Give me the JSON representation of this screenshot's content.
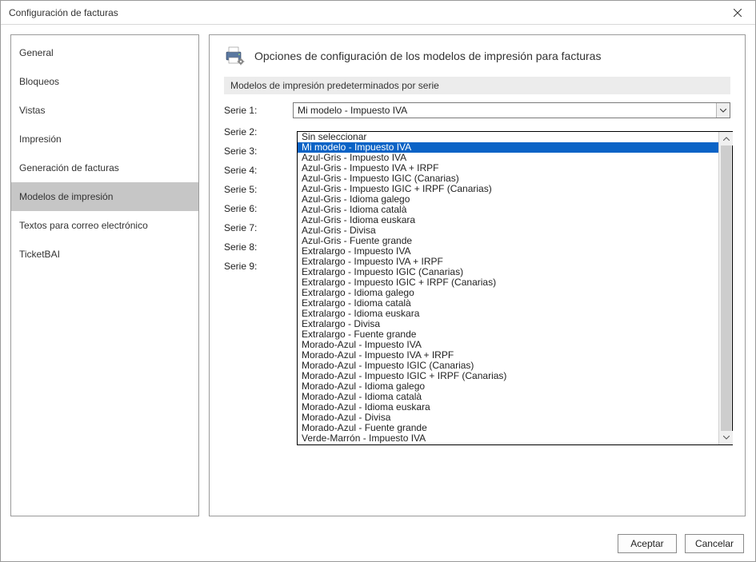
{
  "window": {
    "title": "Configuración de facturas"
  },
  "sidebar": {
    "items": [
      {
        "label": "General"
      },
      {
        "label": "Bloqueos"
      },
      {
        "label": "Vistas"
      },
      {
        "label": "Impresión"
      },
      {
        "label": "Generación de facturas"
      },
      {
        "label": "Modelos de impresión"
      },
      {
        "label": "Textos para correo electrónico"
      },
      {
        "label": "TicketBAI"
      }
    ]
  },
  "panel": {
    "heading": "Opciones de configuración de los modelos de impresión para facturas",
    "section_title": "Modelos de impresión predeterminados por serie"
  },
  "series": {
    "rows": [
      {
        "label": "Serie 1:",
        "value": "Mi modelo - Impuesto IVA"
      },
      {
        "label": "Serie 2:"
      },
      {
        "label": "Serie 3:"
      },
      {
        "label": "Serie 4:"
      },
      {
        "label": "Serie 5:"
      },
      {
        "label": "Serie 6:"
      },
      {
        "label": "Serie 7:"
      },
      {
        "label": "Serie 8:"
      },
      {
        "label": "Serie 9:"
      }
    ]
  },
  "dropdown": {
    "highlighted": "Mi modelo - Impuesto IVA",
    "options": [
      "Sin seleccionar",
      "Mi modelo - Impuesto IVA",
      "Azul-Gris - Impuesto IVA",
      "Azul-Gris - Impuesto IVA + IRPF",
      "Azul-Gris - Impuesto IGIC (Canarias)",
      "Azul-Gris - Impuesto IGIC + IRPF (Canarias)",
      "Azul-Gris - Idioma galego",
      "Azul-Gris - Idioma català",
      "Azul-Gris - Idioma euskara",
      "Azul-Gris - Divisa",
      "Azul-Gris - Fuente grande",
      "Extralargo - Impuesto IVA",
      "Extralargo - Impuesto IVA + IRPF",
      "Extralargo - Impuesto IGIC (Canarias)",
      "Extralargo - Impuesto IGIC + IRPF (Canarias)",
      "Extralargo - Idioma galego",
      "Extralargo - Idioma català",
      "Extralargo - Idioma euskara",
      "Extralargo - Divisa",
      "Extralargo - Fuente grande",
      "Morado-Azul - Impuesto IVA",
      "Morado-Azul - Impuesto IVA + IRPF",
      "Morado-Azul - Impuesto IGIC (Canarias)",
      "Morado-Azul - Impuesto IGIC + IRPF (Canarias)",
      "Morado-Azul - Idioma galego",
      "Morado-Azul - Idioma català",
      "Morado-Azul - Idioma euskara",
      "Morado-Azul - Divisa",
      "Morado-Azul - Fuente grande",
      "Verde-Marrón - Impuesto IVA"
    ]
  },
  "footer": {
    "accept": "Aceptar",
    "cancel": "Cancelar"
  }
}
